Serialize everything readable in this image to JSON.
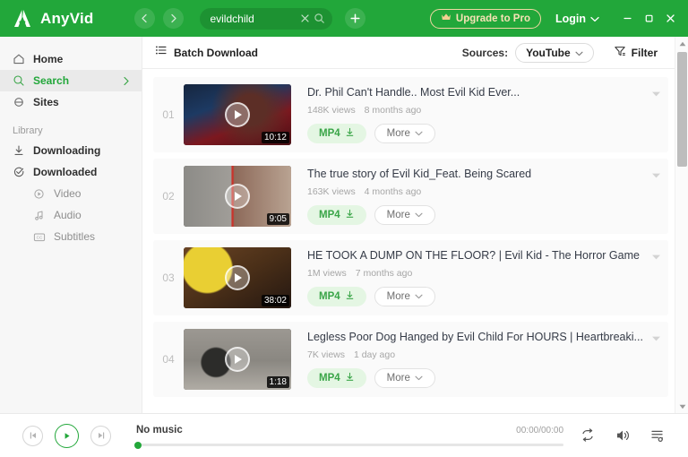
{
  "app": {
    "name": "AnyVid",
    "logo_icon": "anyvid-logo-icon"
  },
  "header": {
    "back_icon": "chevron-left-icon",
    "forward_icon": "chevron-right-icon",
    "search": {
      "value": "evildchild",
      "placeholder": "Search",
      "clear_icon": "close-icon",
      "search_icon": "search-icon"
    },
    "add_tab_icon": "plus-icon",
    "upgrade_label": "Upgrade to Pro",
    "upgrade_icon": "crown-icon",
    "upgrade_border_color": "#f1d7a4",
    "login_label": "Login",
    "login_caret_icon": "chevron-down-icon",
    "minimize_icon": "minimize-icon",
    "maximize_icon": "maximize-icon",
    "close_icon": "close-icon",
    "bg_color": "#22a73a"
  },
  "sidebar": {
    "items": [
      {
        "label": "Home",
        "icon": "home-icon",
        "active": false
      },
      {
        "label": "Search",
        "icon": "search-icon",
        "active": true
      },
      {
        "label": "Sites",
        "icon": "globe-icon",
        "active": false
      }
    ],
    "section_label": "Library",
    "library": [
      {
        "label": "Downloading",
        "icon": "download-icon"
      },
      {
        "label": "Downloaded",
        "icon": "check-circle-icon"
      }
    ],
    "sub_items": [
      {
        "label": "Video",
        "icon": "play-circle-icon"
      },
      {
        "label": "Audio",
        "icon": "music-note-icon"
      },
      {
        "label": "Subtitles",
        "icon": "cc-icon"
      }
    ],
    "active_color": "#22a73a"
  },
  "toolbar": {
    "batch_label": "Batch Download",
    "batch_icon": "list-icon",
    "sources_label": "Sources:",
    "source_value": "YouTube",
    "source_caret_icon": "chevron-down-icon",
    "filter_label": "Filter",
    "filter_icon": "funnel-icon"
  },
  "results": [
    {
      "index": "01",
      "title": "Dr. Phil Can't Handle.. Most Evil Kid Ever...",
      "views": "148K views",
      "age": "8 months ago",
      "duration": "10:12",
      "format_label": "MP4",
      "more_label": "More",
      "thumb_colors": [
        "#1b2f52",
        "#8e1d24",
        "#3a4a63"
      ]
    },
    {
      "index": "02",
      "title": "The true story of Evil Kid_Feat. Being Scared",
      "views": "163K views",
      "age": "4 months ago",
      "duration": "9:05",
      "format_label": "MP4",
      "more_label": "More",
      "thumb_colors": [
        "#8c8c88",
        "#b8584e",
        "#6d5f55"
      ]
    },
    {
      "index": "03",
      "title": "HE TOOK A DUMP ON THE FLOOR? | Evil Kid - The Horror Game",
      "views": "1M views",
      "age": "7 months ago",
      "duration": "38:02",
      "format_label": "MP4",
      "more_label": "More",
      "thumb_colors": [
        "#5c3a20",
        "#d8c32e",
        "#33231a"
      ]
    },
    {
      "index": "04",
      "title": "Legless Poor Dog Hanged by Evil Child For HOURS | Heartbreaki...",
      "views": "7K views",
      "age": "1 day ago",
      "duration": "1:18",
      "format_label": "MP4",
      "more_label": "More",
      "thumb_colors": [
        "#8d8a86",
        "#3b3a38",
        "#a9a49c"
      ]
    }
  ],
  "row_caret_icon": "chevron-down-icon",
  "download_icon": "download-icon",
  "scrollbar": {
    "up_icon": "caret-up-icon",
    "down_icon": "caret-down-icon"
  },
  "player": {
    "prev_icon": "skip-back-icon",
    "play_icon": "play-icon",
    "next_icon": "skip-forward-icon",
    "title": "No music",
    "time": "00:00/00:00",
    "repeat_icon": "repeat-icon",
    "volume_icon": "volume-icon",
    "playlist_icon": "playlist-icon",
    "accent_color": "#22a73a"
  }
}
